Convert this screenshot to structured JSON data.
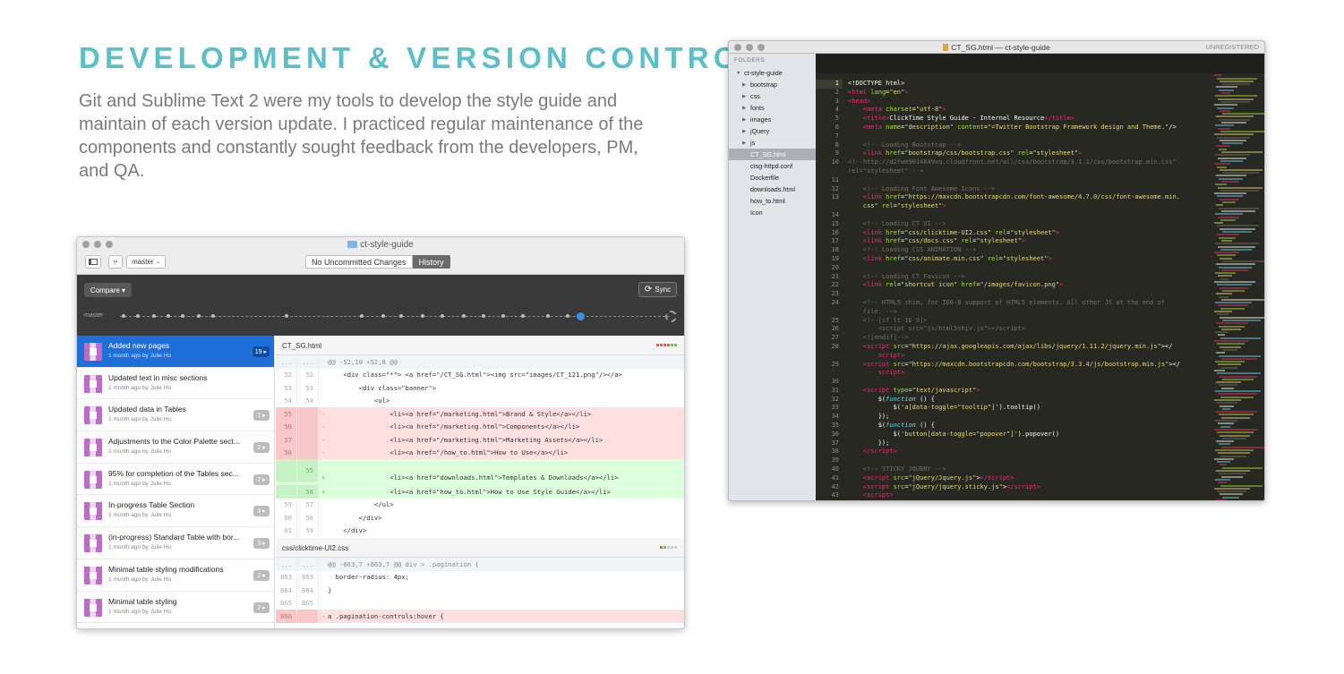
{
  "heading": "DEVELOPMENT & VERSION CONTROL",
  "intro": "Git and Sublime Text 2 were my tools to develop the style guide and maintain of each version update. I practiced regular maintenance of the components and constantly sought feedback from the developers, PM, and QA.",
  "github": {
    "window_title": "ct-style-guide",
    "branch": "master",
    "tab_changes": "No Uncommitted Changes",
    "tab_history": "History",
    "compare": "Compare ▾",
    "sync": "Sync",
    "timeline_label": "master",
    "commits": [
      {
        "title": "Added new pages",
        "sub": "1 month ago by Julie Ho",
        "badge": "19 ▸"
      },
      {
        "title": "Updated text in misc sections",
        "sub": "1 month ago by Julie Ho",
        "badge": ""
      },
      {
        "title": "Updated data in Tables",
        "sub": "1 month ago by Julie Ho",
        "badge": "2 ▸"
      },
      {
        "title": "Adjustments to the Color Palette sect...",
        "sub": "1 month ago by Julie Ho",
        "badge": "2 ▸"
      },
      {
        "title": "95% for completion of the Tables sec...",
        "sub": "1 month ago by Julie Ho",
        "badge": "2 ▸"
      },
      {
        "title": "In-progress Table Section",
        "sub": "1 month ago by Julie Ho",
        "badge": "3 ▸"
      },
      {
        "title": "(in-progress) Standard Table with bor...",
        "sub": "1 month ago by Julie Ho",
        "badge": "3 ▸"
      },
      {
        "title": "Minimal table styling modifications",
        "sub": "1 month ago by Julie Ho",
        "badge": "2 ▸"
      },
      {
        "title": "Minimal table styling",
        "sub": "1 month ago by Julie Ho",
        "badge": "2 ▸"
      }
    ],
    "file1": "CT_SG.html",
    "diff1": [
      {
        "type": "hunk",
        "l": "...",
        "r": "...",
        "m": "",
        "code": "@@ -52,10 +52,8 @@"
      },
      {
        "type": "ctx",
        "l": "52",
        "r": "52",
        "m": "",
        "code": "    <div class=\"*\"> <a href=\"/CT_SG.html\"><img src=\"images/CT_121.png\"/></a>"
      },
      {
        "type": "ctx",
        "l": "53",
        "r": "53",
        "m": "",
        "code": "        <div class=\"banner\">"
      },
      {
        "type": "ctx",
        "l": "54",
        "r": "54",
        "m": "",
        "code": "            <ul>"
      },
      {
        "type": "del",
        "l": "55",
        "r": "",
        "m": "-",
        "code": "                <li><a href=\"/marketing.html\">Brand & Style</a></li>"
      },
      {
        "type": "del",
        "l": "56",
        "r": "",
        "m": "-",
        "code": "                <li><a href=\"/marketing.html\">Components</a></li>"
      },
      {
        "type": "del",
        "l": "57",
        "r": "",
        "m": "-",
        "code": "                <li><a href=\"/marketing.html\">Marketing Assets</a></li>"
      },
      {
        "type": "del",
        "l": "58",
        "r": "",
        "m": "-",
        "code": "                <li><a href=\"/how_to.html\">How to Use</a></li>"
      },
      {
        "type": "add tall",
        "l": "",
        "r": "55",
        "m": "+",
        "code": "                <li><a href=\"downloads.html\">Templates & Downloads</a></li>"
      },
      {
        "type": "add",
        "l": "",
        "r": "56",
        "m": "+",
        "code": "                <li><a href=\"how_to.html\">How to Use Style Guide</a></li>"
      },
      {
        "type": "ctx",
        "l": "59",
        "r": "57",
        "m": "",
        "code": "            </ul>"
      },
      {
        "type": "ctx",
        "l": "60",
        "r": "58",
        "m": "",
        "code": "        </div>"
      },
      {
        "type": "ctx",
        "l": "61",
        "r": "59",
        "m": "",
        "code": "    </div>"
      }
    ],
    "file2": "css/clicktime-UI2.css",
    "diff2": [
      {
        "type": "hunk",
        "l": "...",
        "r": "...",
        "m": "",
        "code": "@@ -863,7 +863,7 @@ div > .pagination {"
      },
      {
        "type": "ctx",
        "l": "863",
        "r": "863",
        "m": "",
        "code": "  border-radius: 4px;"
      },
      {
        "type": "ctx",
        "l": "864",
        "r": "864",
        "m": "",
        "code": "}"
      },
      {
        "type": "ctx",
        "l": "865",
        "r": "865",
        "m": "",
        "code": ""
      },
      {
        "type": "del",
        "l": "866",
        "r": "",
        "m": "-",
        "code": "a .pagination-controls:hover {"
      }
    ]
  },
  "sublime": {
    "window_title": "CT_SG.html — ct-style-guide",
    "unregistered": "UNREGISTERED",
    "folders_label": "FOLDERS",
    "tree": [
      {
        "label": "ct-style-guide",
        "indent": 1,
        "tri": "▼",
        "sel": false
      },
      {
        "label": "bootstrap",
        "indent": 2,
        "tri": "▶",
        "sel": false
      },
      {
        "label": "css",
        "indent": 2,
        "tri": "▶",
        "sel": false
      },
      {
        "label": "fonts",
        "indent": 2,
        "tri": "▶",
        "sel": false
      },
      {
        "label": "images",
        "indent": 2,
        "tri": "▶",
        "sel": false
      },
      {
        "label": "jQuery",
        "indent": 2,
        "tri": "▶",
        "sel": false
      },
      {
        "label": "js",
        "indent": 2,
        "tri": "▶",
        "sel": false
      },
      {
        "label": "CT_SG.html",
        "indent": 3,
        "tri": "",
        "sel": true
      },
      {
        "label": "ctsg-httpd.conf",
        "indent": 3,
        "tri": "",
        "sel": false
      },
      {
        "label": "Dockerfile",
        "indent": 3,
        "tri": "",
        "sel": false
      },
      {
        "label": "downloads.html",
        "indent": 3,
        "tri": "",
        "sel": false
      },
      {
        "label": "how_to.html",
        "indent": 3,
        "tri": "",
        "sel": false
      },
      {
        "label": "Icon",
        "indent": 3,
        "tri": "",
        "sel": false
      }
    ],
    "code": [
      {
        "n": "1",
        "h": "<span class=\"t0\">&lt;!DOCTYPE html&gt;</span>"
      },
      {
        "n": "2",
        "h": "<span class='tg'>&lt;html</span> <span class='at'>lang</span>=<span class='st'>\"en\"</span><span class='tg'>&gt;</span>"
      },
      {
        "n": "3",
        "h": "<span class='tg'>&lt;head&gt;</span>"
      },
      {
        "n": "4",
        "h": "    <span class='tg'>&lt;meta</span> <span class='at'>charset</span>=<span class='st'>\"utf-8\"</span><span class='tg'>&gt;</span>"
      },
      {
        "n": "5",
        "h": "    <span class='tg'>&lt;title&gt;</span>ClickTime Style Guide - Internal Resource<span class='tg'>&lt;/title&gt;</span>"
      },
      {
        "n": "6",
        "h": "    <span class='tg'>&lt;meta</span> <span class='at'>name</span>=<span class='st'>\"description\"</span> <span class='at'>content</span>=<span class='st'>\"=Twitter Bootstrap Framework design and Theme.\"</span>/&gt;"
      },
      {
        "n": "7",
        "h": ""
      },
      {
        "n": "8",
        "h": "    <span class='cm'>&lt;!-- Loading Bootstrap --&gt;</span>"
      },
      {
        "n": "9",
        "h": "    <span class='tg'>&lt;link</span> <span class='at'>href</span>=<span class='st'>\"bootstrap/css/bootstrap.css\"</span> <span class='at'>rel</span>=<span class='st'>\"stylesheet\"</span><span class='tg'>&gt;</span>"
      },
      {
        "n": "10",
        "h": "<span class='cm'>&lt;!--http://d2fwm9014849xq.cloudfront.net/all/css/bootstrap/3.1.1/css/bootstrap.min.css\"</span>"
      },
      {
        "n": "",
        "h": "<span class='cm'>rel=\"stylesheet\" --&gt;</span>"
      },
      {
        "n": "11",
        "h": ""
      },
      {
        "n": "12",
        "h": "    <span class='cm'>&lt;!-- Loading Font Awesome Icons --&gt;</span>"
      },
      {
        "n": "13",
        "h": "    <span class='tg'>&lt;link</span> <span class='at'>href</span>=<span class='st'>\"https://maxcdn.bootstrapcdn.com/font-awesome/4.7.0/css/font-awesome.min.</span>"
      },
      {
        "n": "",
        "h": "    <span class='st'>css\"</span> <span class='at'>rel</span>=<span class='st'>\"stylesheet\"</span><span class='tg'>&gt;</span>"
      },
      {
        "n": "14",
        "h": ""
      },
      {
        "n": "15",
        "h": "    <span class='cm'>&lt;!-- Loading CT UI --&gt;</span>"
      },
      {
        "n": "16",
        "h": "    <span class='tg'>&lt;link</span> <span class='at'>href</span>=<span class='st'>\"css/clicktime-UI2.css\"</span> <span class='at'>rel</span>=<span class='st'>\"stylesheet\"</span><span class='tg'>&gt;</span>"
      },
      {
        "n": "17",
        "h": "    <span class='tg'>&lt;link</span> <span class='at'>href</span>=<span class='st'>\"css/docs.css\"</span> <span class='at'>rel</span>=<span class='st'>\"stylesheet\"</span><span class='tg'>&gt;</span>"
      },
      {
        "n": "18",
        "h": "    <span class='cm'>&lt;!-- Loading CSS ANIMATION --&gt;</span>"
      },
      {
        "n": "19",
        "h": "    <span class='tg'>&lt;link</span> <span class='at'>href</span>=<span class='st'>\"css/animate.min.css\"</span> <span class='at'>rel</span>=<span class='st'>\"stylesheet\"</span><span class='tg'>&gt;</span>"
      },
      {
        "n": "20",
        "h": ""
      },
      {
        "n": "21",
        "h": "    <span class='cm'>&lt;!-- Loading CT Favicon --&gt;</span>"
      },
      {
        "n": "22",
        "h": "    <span class='tg'>&lt;link</span> <span class='at'>rel</span>=<span class='st'>\"shortcut icon\"</span> <span class='at'>href</span>=<span class='st'>\"/images/favicon.png\"</span><span class='tg'>&gt;</span>"
      },
      {
        "n": "23",
        "h": ""
      },
      {
        "n": "24",
        "h": "    <span class='cm'>&lt;!-- HTML5 shim, for IE6-8 support of HTML5 elements. All other JS at the end of</span>"
      },
      {
        "n": "",
        "h": "    <span class='cm'>file. --&gt;</span>"
      },
      {
        "n": "25",
        "h": "    <span class='cm'>&lt;!--[if lt IE 9]&gt;</span>"
      },
      {
        "n": "26",
        "h": "        <span class='cm'>&lt;script src=\"js/html5shiv.js\"&gt;&lt;/script&gt;</span>"
      },
      {
        "n": "27",
        "h": "    <span class='cm'>&lt;![endif]--&gt;</span>"
      },
      {
        "n": "28",
        "h": "    <span class='tg'>&lt;script</span> <span class='at'>src</span>=<span class='st'>\"https://ajax.googleapis.com/ajax/libs/jquery/1.11.2/jquery.min.js\"</span>&gt;&lt;/"
      },
      {
        "n": "",
        "h": "        <span class='tg'>script&gt;</span>"
      },
      {
        "n": "29",
        "h": "    <span class='tg'>&lt;script</span> <span class='at'>src</span>=<span class='st'>\"https://maxcdn.bootstrapcdn.com/bootstrap/3.3.4/js/bootstrap.min.js\"</span>&gt;&lt;/"
      },
      {
        "n": "",
        "h": "        <span class='tg'>script&gt;</span>"
      },
      {
        "n": "30",
        "h": ""
      },
      {
        "n": "31",
        "h": "    <span class='tg'>&lt;script</span> <span class='at'>type</span>=<span class='st'>\"text/javascript\"</span><span class='tg'>&gt;</span>"
      },
      {
        "n": "32",
        "h": "        $(<span class='kw'>function</span> () {"
      },
      {
        "n": "33",
        "h": "            $(<span class='st'>'a[data-toggle=\"tooltip\"]'</span>).tooltip()"
      },
      {
        "n": "34",
        "h": "        });"
      },
      {
        "n": "35",
        "h": "        $(<span class='kw'>function</span> () {"
      },
      {
        "n": "36",
        "h": "            $(<span class='st'>'button[data-toggle=\"popover\"]'</span>).popover()"
      },
      {
        "n": "37",
        "h": "        });"
      },
      {
        "n": "38",
        "h": "    <span class='tg'>&lt;/script&gt;</span>"
      },
      {
        "n": "39",
        "h": ""
      },
      {
        "n": "40",
        "h": "    <span class='cm'>&lt;!-- STICKY JQUERY --&gt;</span>"
      },
      {
        "n": "41",
        "h": "    <span class='tg'>&lt;script</span> <span class='at'>src</span>=<span class='st'>\"jQuery/Jquery.js\"</span>&gt;<span class='tg'>&lt;/script&gt;</span>"
      },
      {
        "n": "42",
        "h": "    <span class='tg'>&lt;script</span> <span class='at'>src</span>=<span class='st'>\"jQuery/jquery.sticky.js\"</span>&gt;<span class='tg'>&lt;/script&gt;</span>"
      },
      {
        "n": "43",
        "h": "    <span class='tg'>&lt;script&gt;</span>"
      },
      {
        "n": "44",
        "h": "      $(<span class='kw'>document</span>).ready(<span class='kw'>function</span>(){"
      }
    ]
  }
}
